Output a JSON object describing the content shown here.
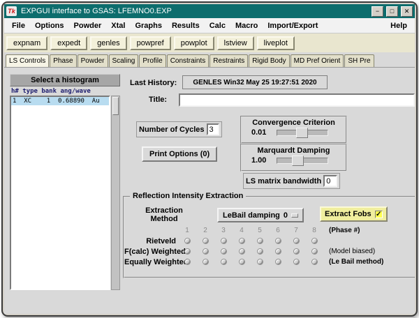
{
  "window": {
    "icon_text": "Tk",
    "title": "EXPGUI interface to GSAS: LFEMNO0.EXP",
    "minimize_glyph": "−",
    "maximize_glyph": "□",
    "close_glyph": "✕"
  },
  "menubar": {
    "items": [
      "File",
      "Options",
      "Powder",
      "Xtal",
      "Graphs",
      "Results",
      "Calc",
      "Macro",
      "Import/Export"
    ],
    "help": "Help"
  },
  "toolbar": {
    "buttons": [
      "expnam",
      "expedt",
      "genles",
      "powpref",
      "powplot",
      "lstview",
      "liveplot"
    ]
  },
  "tabs": [
    "LS Controls",
    "Phase",
    "Powder",
    "Scaling",
    "Profile",
    "Constraints",
    "Restraints",
    "Rigid Body",
    "MD Pref Orient",
    "SH Pre"
  ],
  "histogram": {
    "header": "Select a histogram",
    "columns": "h# type bank ang/wave",
    "row": "1  XC    1  0.68890  Au"
  },
  "fields": {
    "last_history_label": "Last History:",
    "last_history_value": "GENLES Win32 May 25 19:27:51 2020",
    "title_label": "Title:",
    "title_value": "",
    "cycles_label": "Number of Cycles",
    "cycles_value": "3",
    "print_button": "Print Options (0)",
    "bandwidth_label": "LS matrix bandwidth",
    "bandwidth_value": "0"
  },
  "convergence": {
    "title": "Convergence Criterion",
    "value": "0.01"
  },
  "marquardt": {
    "title": "Marquardt Damping",
    "value": "1.00"
  },
  "extraction": {
    "title": "Reflection Intensity Extraction",
    "method_label": "Extraction\nMethod",
    "lebail_label": "LeBail damping",
    "lebail_value": "0",
    "fobs_label": "Extract Fobs",
    "fobs_check": "✓",
    "phase_numbers": [
      "1",
      "2",
      "3",
      "4",
      "5",
      "6",
      "7",
      "8"
    ],
    "phase_note": "(Phase #)",
    "row1_label": "Rietveld",
    "row2_label": "F(calc) Weighted",
    "row2_note": "(Model biased)",
    "row3_label": "Equally Weighted",
    "row3_note": "(Le Bail method)"
  }
}
